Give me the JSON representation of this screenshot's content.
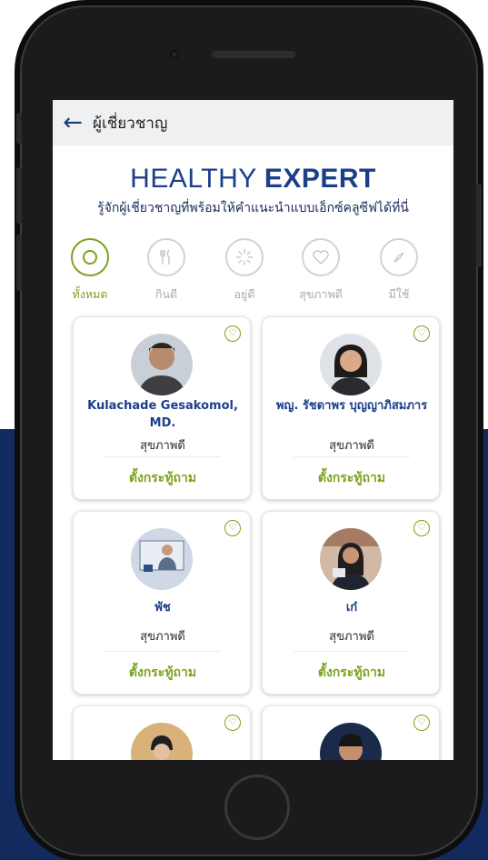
{
  "appbar": {
    "back_icon": "arrow-left-icon",
    "title": "ผู้เชี่ยวชาญ"
  },
  "hero": {
    "title_light": "HEALTHY",
    "title_bold": "EXPERT",
    "tagline": "รู้จักผู้เชี่ยวชาญที่พร้อมให้คำแนะนำแบบเอ็กซ์คลูซีฟได้ที่นี่"
  },
  "categories": [
    {
      "label": "ทั้งหมด",
      "icon": "circle-target-icon",
      "active": true
    },
    {
      "label": "กินดี",
      "icon": "utensils-icon",
      "active": false
    },
    {
      "label": "อยู่ดี",
      "icon": "sparkle-icon",
      "active": false
    },
    {
      "label": "สุขภาพดี",
      "icon": "heart-icon",
      "active": false
    },
    {
      "label": "มีใช้",
      "icon": "compass-icon",
      "active": false
    }
  ],
  "experts": [
    {
      "name": "Kulachade Gesakomol, MD.",
      "category": "สุขภาพดี",
      "action": "ตั้งกระทู้ถาม"
    },
    {
      "name": "พญ. รัชดาพร บุญญาภิสมภาร",
      "category": "สุขภาพดี",
      "action": "ตั้งกระทู้ถาม"
    },
    {
      "name": "พัช",
      "category": "สุขภาพดี",
      "action": "ตั้งกระทู้ถาม"
    },
    {
      "name": "เก๋",
      "category": "สุขภาพดี",
      "action": "ตั้งกระทู้ถาม"
    }
  ],
  "colors": {
    "brand_navy": "#1c3f8a",
    "accent_green": "#7da21c",
    "background_navy": "#132a5e"
  }
}
